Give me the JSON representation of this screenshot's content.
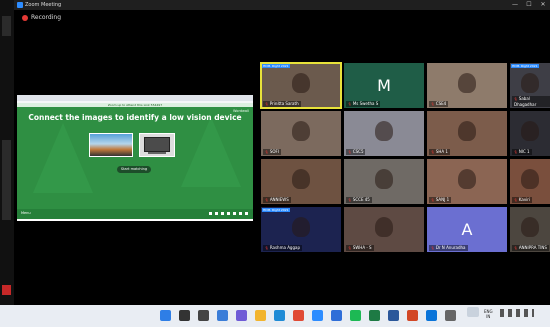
{
  "window": {
    "title": "Zoom Meeting"
  },
  "recording": {
    "label": "Recording"
  },
  "share": {
    "top_banner": "Zoom up to Attend this Link 554497",
    "logo_text": "Wordwall",
    "headline": "Connect the images to identify a low vision device",
    "button_label": "Start matching",
    "bottom_left_label": "Menu"
  },
  "participants": [
    {
      "name": "Prinitta Sarath",
      "kind": "video",
      "bg": "#6b5a4d",
      "active": true,
      "caption": "HDM. Right 2021"
    },
    {
      "name": "Ms Swetha S",
      "kind": "letter",
      "letter": "M",
      "bg": "#1f5d47"
    },
    {
      "name": "CSE4",
      "kind": "video",
      "bg": "#8e7b6b"
    },
    {
      "name": "Sabal Dhagadhar",
      "kind": "video",
      "bg": "#3e3e46",
      "caption": "HDM. Right 2021"
    },
    {
      "name": "SOFI",
      "kind": "video",
      "bg": "#7c6a5e"
    },
    {
      "name": "CSC5",
      "kind": "video",
      "bg": "#8a8a95"
    },
    {
      "name": "SHA 1",
      "kind": "video",
      "bg": "#7c5c4b"
    },
    {
      "name": "NIC 1",
      "kind": "video",
      "bg": "#2c2c33"
    },
    {
      "name": "ANNIEWS",
      "kind": "video",
      "bg": "#6e5241"
    },
    {
      "name": "SCCE 45",
      "kind": "video",
      "bg": "#6f6a65"
    },
    {
      "name": "SANJ 1",
      "kind": "video",
      "bg": "#8b6553"
    },
    {
      "name": "Kaviri",
      "kind": "video",
      "bg": "#7a4f3d"
    },
    {
      "name": "Rashma Aggap",
      "kind": "video",
      "bg": "#1c2350",
      "caption": "HDM. Right 2021"
    },
    {
      "name": "SWHA - S",
      "kind": "video",
      "bg": "#5e4a43"
    },
    {
      "name": "Dr N Anuradha",
      "kind": "letter",
      "letter": "A",
      "bg": "#6b6fd1"
    },
    {
      "name": "ANNIPRA TINS",
      "kind": "video",
      "bg": "#4c463f"
    }
  ],
  "taskbar": {
    "icons": [
      "windows-start",
      "search",
      "task-view",
      "widgets",
      "chat",
      "file-explorer",
      "edge",
      "chrome",
      "zoom",
      "store",
      "spotify",
      "excel",
      "word",
      "powerpoint",
      "mail",
      "settings"
    ],
    "icon_colors": [
      "#2e7ee6",
      "#333",
      "#444",
      "#3b7dd8",
      "#6f5bd6",
      "#f2b42e",
      "#1f8bd6",
      "#e04a35",
      "#2d8cff",
      "#2f6ed8",
      "#1db954",
      "#1e7a44",
      "#2b579a",
      "#d24726",
      "#0a74d9",
      "#666"
    ],
    "lang": "ENG",
    "lang_sub": "IN"
  }
}
